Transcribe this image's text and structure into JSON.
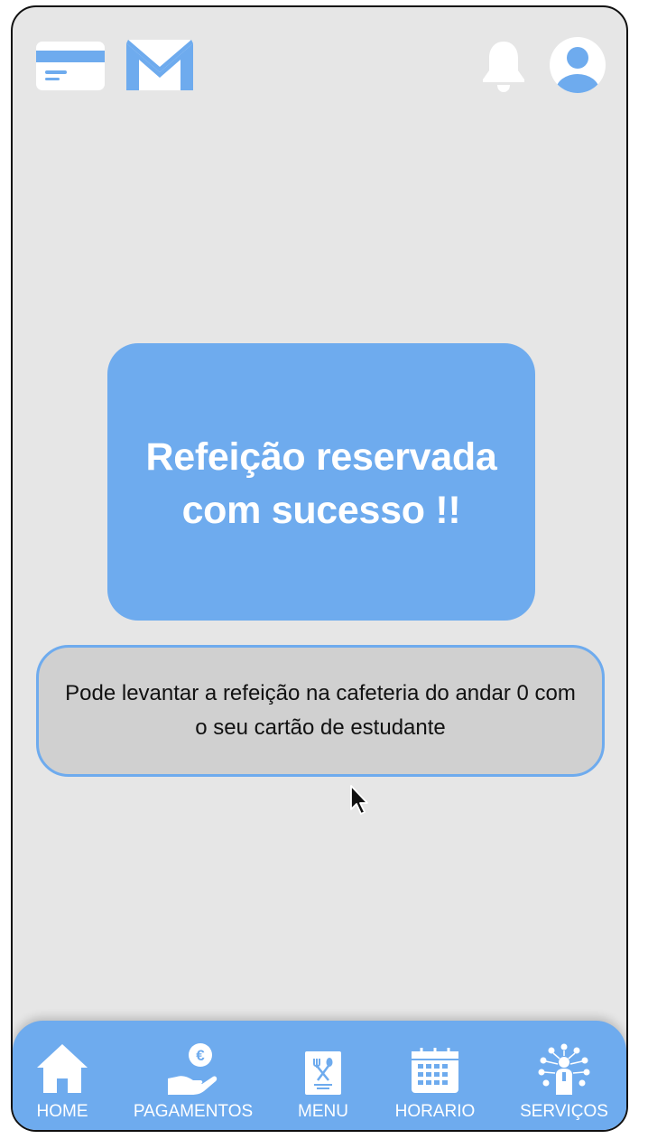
{
  "header": {
    "icons": [
      "card-icon",
      "mail-icon",
      "bell-icon",
      "avatar-icon"
    ]
  },
  "success": {
    "message": "Refeição reservada com sucesso !!"
  },
  "info": {
    "message": "Pode levantar a refeição na cafeteria do andar 0 com o seu cartão de estudante"
  },
  "nav": {
    "items": [
      {
        "label": "HOME",
        "icon": "home-icon"
      },
      {
        "label": "PAGAMENTOS",
        "icon": "payment-icon"
      },
      {
        "label": "MENU",
        "icon": "menu-icon"
      },
      {
        "label": "HORARIO",
        "icon": "calendar-icon"
      },
      {
        "label": "SERVIÇOS",
        "icon": "services-icon"
      }
    ]
  },
  "colors": {
    "accent": "#6eabee",
    "background": "#e6e6e6",
    "info_box": "#d0d0d0"
  }
}
